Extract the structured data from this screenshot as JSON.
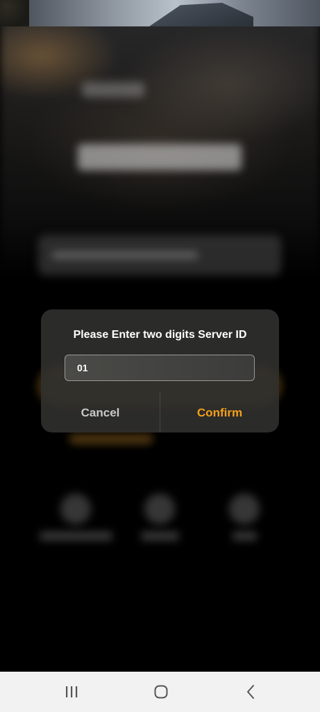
{
  "dialog": {
    "title": "Please Enter two digits Server ID",
    "input_value": "01",
    "cancel_label": "Cancel",
    "confirm_label": "Confirm"
  },
  "nav": {
    "recents_icon": "recents-icon",
    "home_icon": "home-icon",
    "back_icon": "back-icon"
  },
  "colors": {
    "confirm": "#f4a01c",
    "dialog_bg": "#2e2e2c",
    "navbar_bg": "#f2f2f2"
  }
}
